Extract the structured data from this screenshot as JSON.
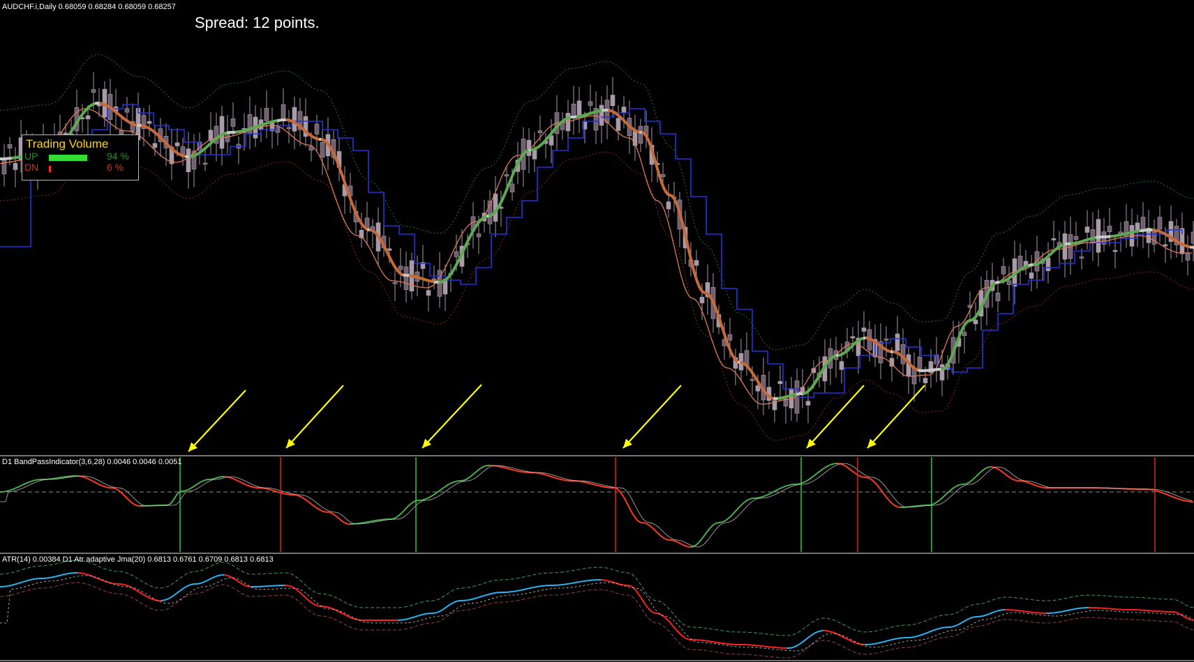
{
  "main_pane": {
    "symbol_label": "AUDCHF.i,Daily  0.68059 0.68284 0.68059 0.68257",
    "spread_text": "Spread: 12 points."
  },
  "trading_volume": {
    "title": "Trading Volume",
    "up_label": "UP",
    "up_pct": "94 %",
    "up_fraction": 0.94,
    "dn_label": "DN",
    "dn_pct": "6 %",
    "dn_fraction": 0.06
  },
  "bandpass_pane": {
    "label": "D1 BandPassIndicator(3,6,28) 0.0046 0.0046 0.0051"
  },
  "atr_pane": {
    "label": "ATR(14) 0.00384  D1 Atr adaptive Jma(20) 0.6813 0.6761 0.6709 0.6813 0.6813"
  },
  "colors": {
    "background": "#000000",
    "candle": "#a89aa8",
    "smooth_up": "#5ea851",
    "smooth_down": "#c66a3a",
    "smooth_neutral": "#c8c8c8",
    "step_line": "#2233dd",
    "fast_line": "#e07a5a",
    "arrow": "#ffff00",
    "bp_green": "#4caf50",
    "bp_red": "#ff3b1f",
    "atr_blue": "#29b6f6",
    "atr_red": "#ff2020",
    "signal_green": "#2ecc40",
    "signal_red": "#e02020"
  }
}
